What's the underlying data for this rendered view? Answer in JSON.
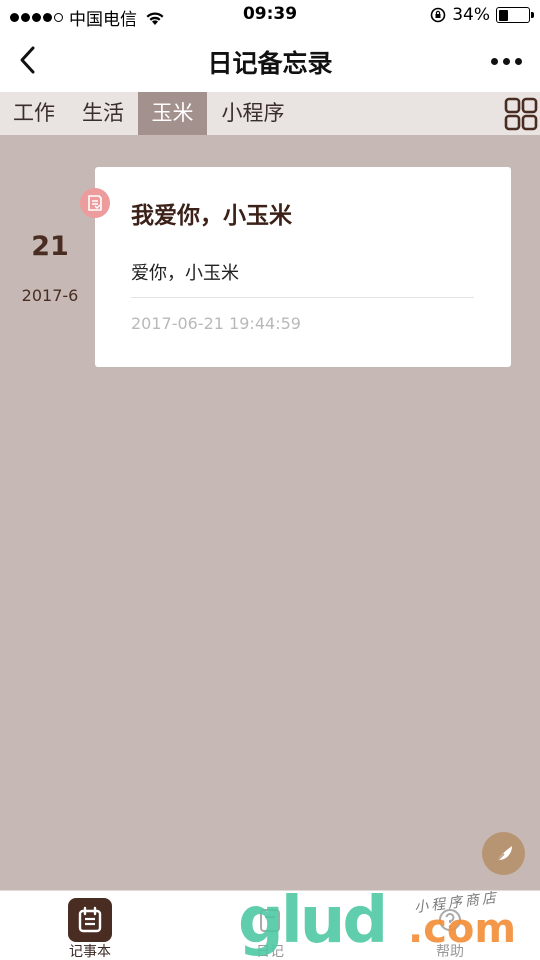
{
  "status_bar": {
    "carrier": "中国电信",
    "time": "09:39",
    "battery_text": "34%",
    "battery_level": 0.34,
    "signal_bars_filled": 4,
    "signal_bars_total": 5
  },
  "header": {
    "title": "日记备忘录",
    "back_icon": "chevron-left-icon",
    "more_icon": "more-dots-icon"
  },
  "tabs": [
    {
      "label": "工作",
      "active": false
    },
    {
      "label": "生活",
      "active": false
    },
    {
      "label": "玉米",
      "active": true
    },
    {
      "label": "小程序",
      "active": false
    }
  ],
  "tab_grid_icon": "grid-icon",
  "entry": {
    "day": "21",
    "month": "2017-6",
    "title": "我爱你，小玉米",
    "body": "爱你，小玉米",
    "timestamp": "2017-06-21 19:44:59",
    "badge_icon": "note-icon"
  },
  "fab_icon": "feather-icon",
  "bottom_tabs": [
    {
      "label": "记事本",
      "icon": "notebook-icon",
      "active": true
    },
    {
      "label": "日记",
      "icon": "diary-icon",
      "active": false
    },
    {
      "label": "帮助",
      "icon": "help-icon",
      "active": false
    }
  ],
  "watermark": {
    "main": "glud",
    "suffix": ".com",
    "sub": "小程序商店"
  },
  "colors": {
    "background": "#c6b8b4",
    "tab_active": "#a3918d",
    "tab_bar": "#e9e3e2",
    "accent_brown": "#4a2d22",
    "badge_pink": "#ec9c9c",
    "fab_gold": "#b89572"
  }
}
